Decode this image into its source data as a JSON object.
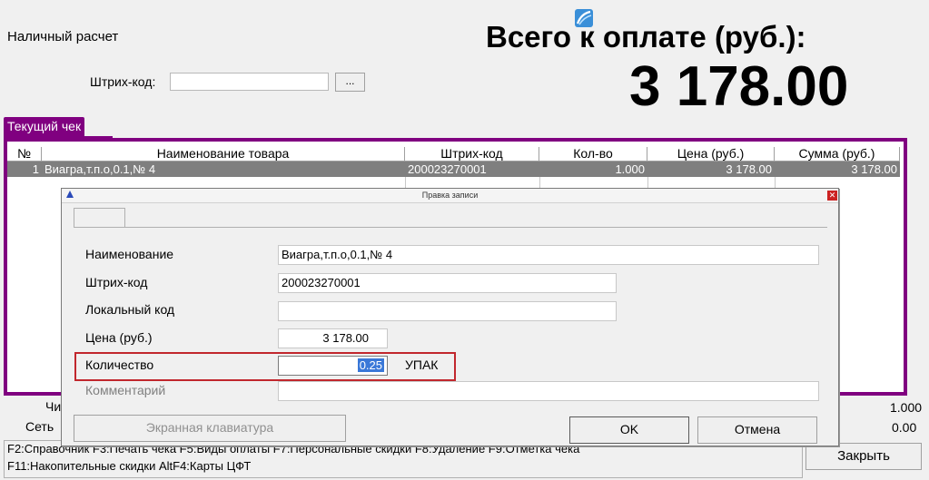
{
  "header": {
    "mode": "Наличный расчет",
    "total_label": "Всего к оплате (руб.):",
    "total_value": "3 178.00",
    "barcode_label": "Штрих-код:",
    "browse_label": "..."
  },
  "receipt": {
    "tab_label": "Текущий чек",
    "columns": [
      "№",
      "Наименование товара",
      "Штрих-код",
      "Кол-во",
      "Цена (руб.)",
      "Сумма (руб.)"
    ],
    "rows": [
      {
        "num": "1",
        "name": "Виагра,т.п.о,0.1,№ 4",
        "barcode": "200023270001",
        "qty": "1.000",
        "price": "3 178.00",
        "sum": "3 178.00"
      }
    ]
  },
  "footer": {
    "label1": "Чи",
    "label2": "Сеть",
    "value1": "1.000",
    "value2": "0.00",
    "hint_line1": "F2:Справочник  F3:Печать чека  F5:Виды оплаты  F7:Персональные скидки  F8:Удаление  F9:Отметка чека",
    "hint_line2": "F11:Накопительные скидки  AltF4:Карты ЦФТ",
    "close_label": "Закрыть"
  },
  "dialog": {
    "title": "Правка записи",
    "fields": {
      "name_label": "Наименование",
      "name_value": "Виагра,т.п.о,0.1,№ 4",
      "barcode_label": "Штрих-код",
      "barcode_value": "200023270001",
      "local_code_label": "Локальный код",
      "local_code_value": "",
      "price_label": "Цена (руб.)",
      "price_value": "3 178.00",
      "qty_label": "Количество",
      "qty_value": "0.25",
      "qty_unit": "УПАК",
      "comment_label": "Комментарий",
      "comment_value": ""
    },
    "keyboard_label": "Экранная клавиатура",
    "ok_label": "OK",
    "cancel_label": "Отмена"
  },
  "colors": {
    "tab": "#800080",
    "selected_row": "#7f7f7f",
    "highlight": "#c1272d",
    "selection": "#3a78d8"
  }
}
